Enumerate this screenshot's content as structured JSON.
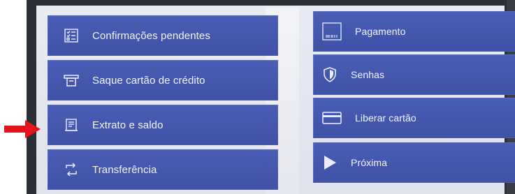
{
  "menu": {
    "left": [
      {
        "label": "Confirmações pendentes",
        "icon": "checklist-icon"
      },
      {
        "label": "Saque cartão de crédito",
        "icon": "card-withdraw-icon"
      },
      {
        "label": "Extrato e saldo",
        "icon": "statement-icon"
      },
      {
        "label": "Transferência",
        "icon": "transfer-icon"
      }
    ],
    "right": [
      {
        "label": "Pagamento",
        "icon": "barcode-icon"
      },
      {
        "label": "Senhas",
        "icon": "shield-icon"
      },
      {
        "label": "Liberar cartão",
        "icon": "credit-card-icon"
      },
      {
        "label": "Próxima",
        "icon": "play-icon"
      }
    ]
  },
  "colors": {
    "button": "#4257ae",
    "pointer_arrow": "#e3141c"
  }
}
